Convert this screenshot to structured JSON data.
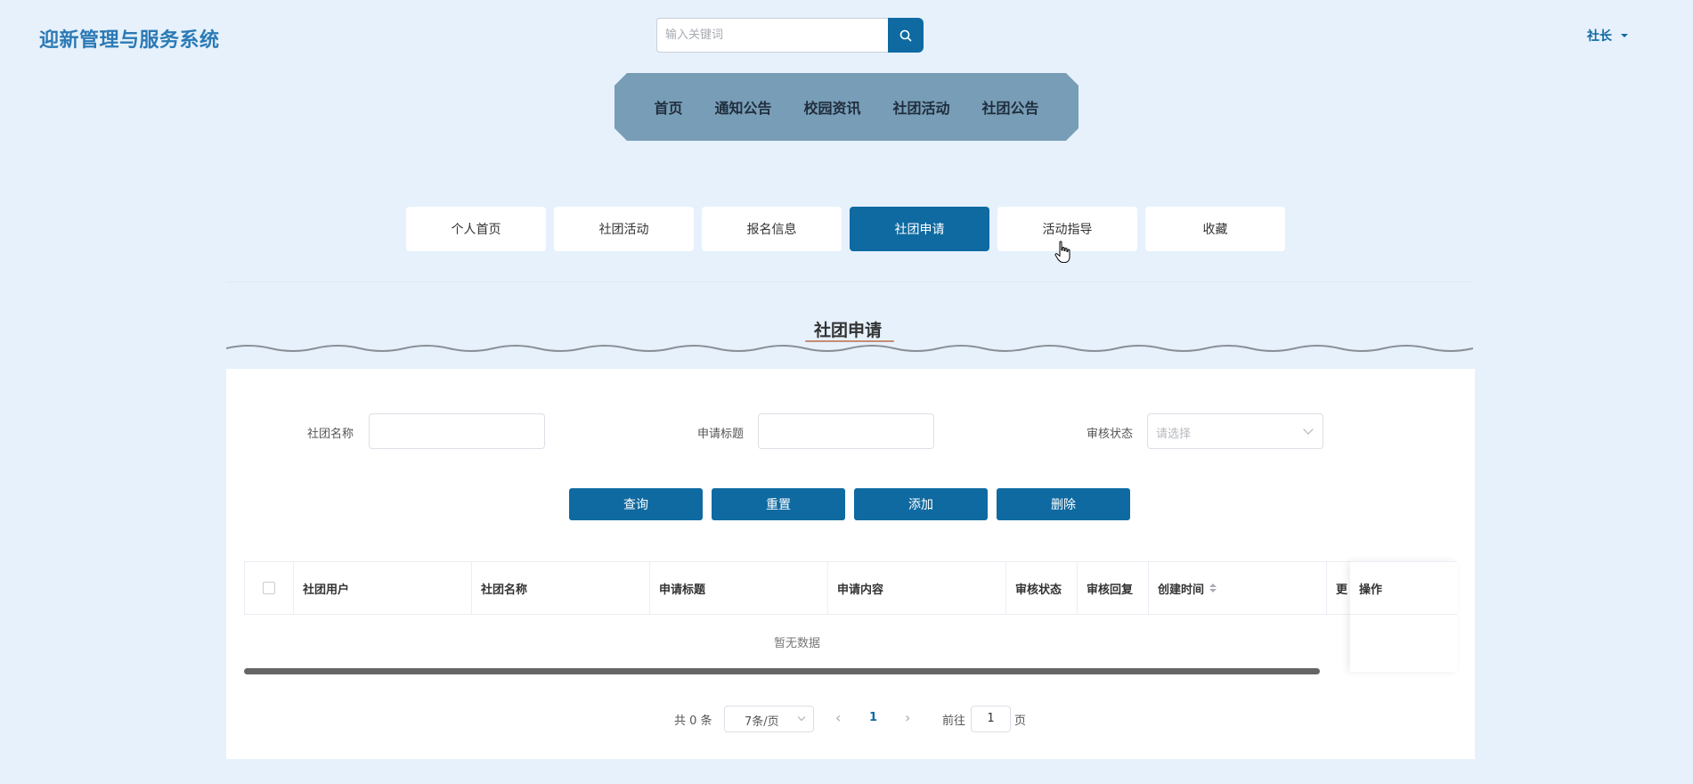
{
  "header": {
    "title": "迎新管理与服务系统",
    "search_placeholder": "输入关键词",
    "user": "社长"
  },
  "nav": [
    "首页",
    "通知公告",
    "校园资讯",
    "社团活动",
    "社团公告"
  ],
  "tabs": [
    {
      "label": "个人首页",
      "active": false
    },
    {
      "label": "社团活动",
      "active": false
    },
    {
      "label": "报名信息",
      "active": false
    },
    {
      "label": "社团申请",
      "active": true
    },
    {
      "label": "活动指导",
      "active": false
    },
    {
      "label": "收藏",
      "active": false
    }
  ],
  "section_title": "社团申请",
  "filters": {
    "club_name_label": "社团名称",
    "apply_title_label": "申请标题",
    "status_label": "审核状态",
    "status_placeholder": "请选择"
  },
  "buttons": {
    "query": "查询",
    "reset": "重置",
    "add": "添加",
    "delete": "删除"
  },
  "table": {
    "columns": [
      "社团用户",
      "社团名称",
      "申请标题",
      "申请内容",
      "审核状态",
      "审核回复",
      "创建时间",
      "更"
    ],
    "action_column": "操作",
    "empty_text": "暂无数据"
  },
  "pagination": {
    "total": "共 0 条",
    "page_size": "7条/页",
    "current_page": "1",
    "goto_label": "前往",
    "goto_value": "1",
    "page_suffix": "页"
  },
  "colors": {
    "primary": "#0f6aa1",
    "nav_bg": "#789db6",
    "page_bg": "#e6f1fc"
  },
  "icons": {
    "search": "search-icon",
    "caret": "caret-down-icon",
    "cursor": "hand-pointer-icon"
  }
}
